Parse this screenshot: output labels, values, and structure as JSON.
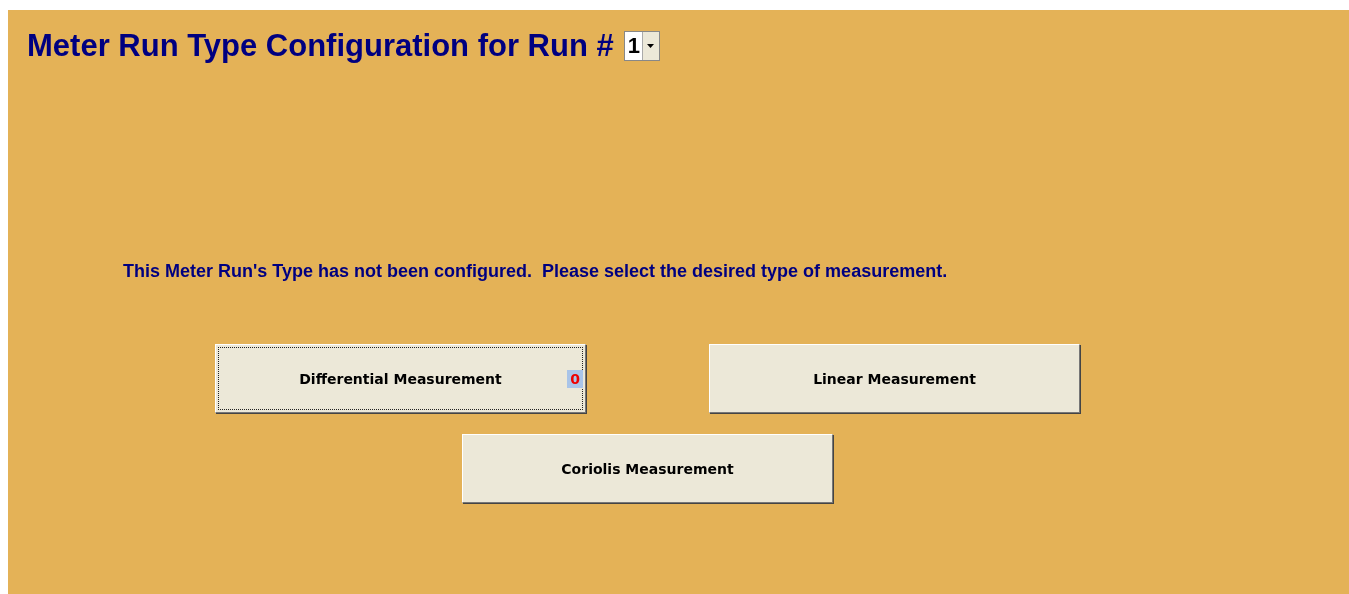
{
  "title": "Meter Run Type Configuration for Run #",
  "run_select": {
    "value": "1"
  },
  "message": "This Meter Run's Type has not been configured.  Please select the desired type of measurement.",
  "buttons": [
    {
      "label": "Differential Measurement",
      "focused": true,
      "badge": "0"
    },
    {
      "label": "Linear Measurement",
      "focused": false
    },
    {
      "label": "Coriolis Measurement",
      "focused": false
    }
  ]
}
